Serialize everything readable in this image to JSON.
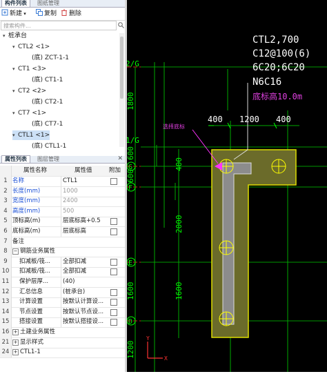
{
  "component_panel": {
    "tabs": [
      {
        "label": "构件列表"
      },
      {
        "label": "图纸管理"
      }
    ],
    "close": "✕",
    "toolbar": {
      "new_label": "新建",
      "copy_label": "复制",
      "delete_label": "删除"
    },
    "search_placeholder": "搜索构件...",
    "tree": [
      {
        "label": "桩承台"
      },
      {
        "label": "CTL2 <1>"
      },
      {
        "label": "(底) ZCT-1-1"
      },
      {
        "label": "CT1 <3>"
      },
      {
        "label": "(底) CT1-1"
      },
      {
        "label": "CT2 <2>"
      },
      {
        "label": "(底) CT2-1"
      },
      {
        "label": "CT7 <1>"
      },
      {
        "label": "(底) CT7-1"
      },
      {
        "label": "CTL1 <1>"
      },
      {
        "label": "(底) CTL1-1"
      }
    ]
  },
  "property_panel": {
    "tabs": [
      {
        "label": "属性列表"
      },
      {
        "label": "图层管理"
      }
    ],
    "header": {
      "name": "属性名称",
      "value": "属性值",
      "add": "附加"
    },
    "rows": [
      {
        "n": "1",
        "k": "名称",
        "v": "CTL1"
      },
      {
        "n": "2",
        "k": "长度(mm)",
        "v": "1000"
      },
      {
        "n": "3",
        "k": "宽度(mm)",
        "v": "2400"
      },
      {
        "n": "4",
        "k": "高度(mm)",
        "v": "500"
      },
      {
        "n": "5",
        "k": "顶标高(m)",
        "v": "层底标高+0.5"
      },
      {
        "n": "6",
        "k": "底标高(m)",
        "v": "层底标高"
      },
      {
        "n": "7",
        "k": "备注",
        "v": ""
      },
      {
        "n": "8",
        "k": "钢筋业务属性",
        "v": ""
      },
      {
        "n": "9",
        "k": "扣减板/筏...",
        "v": "全部扣减"
      },
      {
        "n": "10",
        "k": "扣减板/筏...",
        "v": "全部扣减"
      },
      {
        "n": "11",
        "k": "保护层厚...",
        "v": "(40)"
      },
      {
        "n": "12",
        "k": "汇总信息",
        "v": "(桩承台)"
      },
      {
        "n": "13",
        "k": "计算设置",
        "v": "按默认计算设..."
      },
      {
        "n": "14",
        "k": "节点设置",
        "v": "按默认节点设..."
      },
      {
        "n": "15",
        "k": "搭接设置",
        "v": "按默认搭接设..."
      },
      {
        "n": "16",
        "k": "土建业务属性",
        "v": ""
      },
      {
        "n": "21",
        "k": "显示样式",
        "v": ""
      },
      {
        "n": "24",
        "k": "CTL1-1",
        "v": ""
      }
    ],
    "expanders": {
      "minus": "−",
      "plus": "+"
    }
  },
  "drawing": {
    "annotation": [
      "CTL2,700",
      "C12@100(6)",
      "6C20;6C20",
      "N6C16"
    ],
    "elevation_note": "底标高10.0m",
    "callout": "选择底标",
    "axes_left": [
      "2/G",
      "G",
      "F",
      "E",
      "D"
    ],
    "axis_1g": "1/G",
    "dims_vertical": [
      "1800",
      "600",
      "600",
      "400",
      "2000",
      "1600",
      "1600",
      "1200"
    ],
    "dims_top": [
      "400",
      "1200",
      "400"
    ],
    "ucs_y": "Y",
    "ucs_x": "X",
    "colors": {
      "annotation": "#ffffff",
      "elev": "#e040e0",
      "callout": "#e040e0",
      "axis": "#00ff00",
      "dim": "#00ff00",
      "pile": "#ffff00",
      "cap_fill": "#6b6b2a"
    }
  }
}
